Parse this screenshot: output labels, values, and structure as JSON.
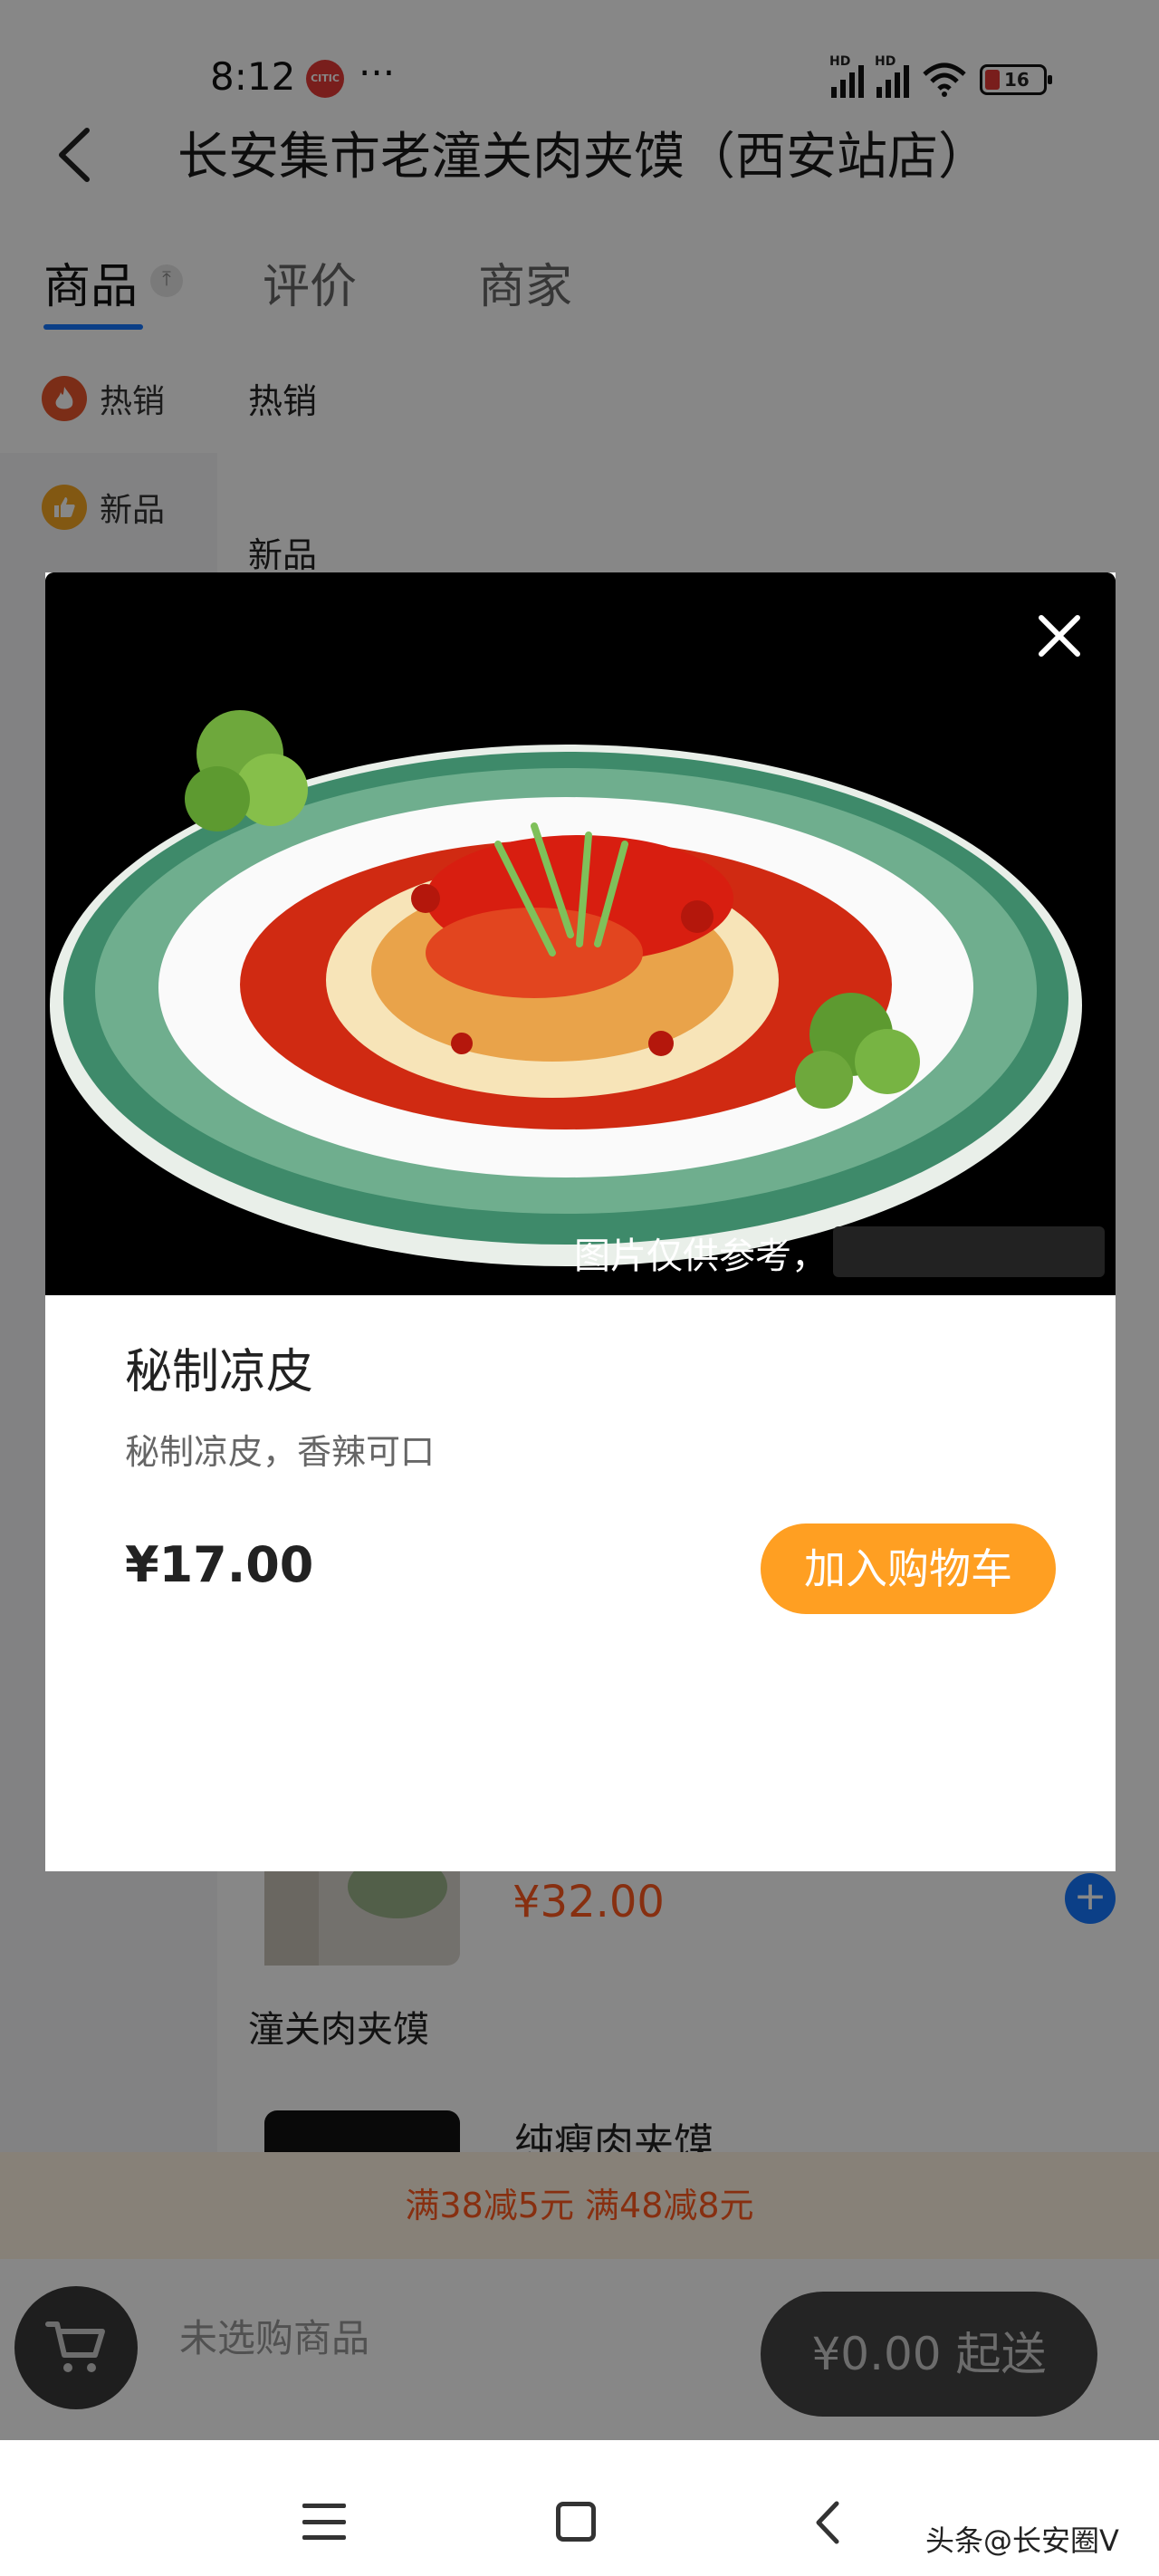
{
  "status_bar": {
    "time": "8:12",
    "dots": "···",
    "app_icon": "CITIC",
    "hd1": "HD",
    "hd2": "HD",
    "battery": "16"
  },
  "header": {
    "title": "长安集市老潼关肉夹馍（西安站店）"
  },
  "tabs": [
    {
      "label": "商品"
    },
    {
      "label": "评价"
    },
    {
      "label": "商家"
    }
  ],
  "sidebar": {
    "items": [
      {
        "label": "热销",
        "icon": "fire-icon"
      },
      {
        "label": "新品",
        "icon": "thumb-up-icon"
      }
    ]
  },
  "list": {
    "sections": [
      "热销",
      "新品"
    ],
    "visible_price": "¥32.00",
    "product_names": [
      "潼关肉夹馍",
      "纯瘦肉夹馍"
    ]
  },
  "modal": {
    "image_caption": "图片仅供参考，",
    "name": "秘制凉皮",
    "description": "秘制凉皮，香辣可口",
    "price": "¥17.00",
    "add_button": "加入购物车"
  },
  "promo": {
    "text": "满38减5元 满48减8元"
  },
  "cart": {
    "empty_text": "未选购商品",
    "checkout": "¥0.00 起送"
  },
  "footer": {
    "watermark": "头条@长安圈V"
  },
  "colors": {
    "accent_blue": "#1677ff",
    "accent_orange": "#ff9f22",
    "promo_text": "#ff5a1f"
  }
}
